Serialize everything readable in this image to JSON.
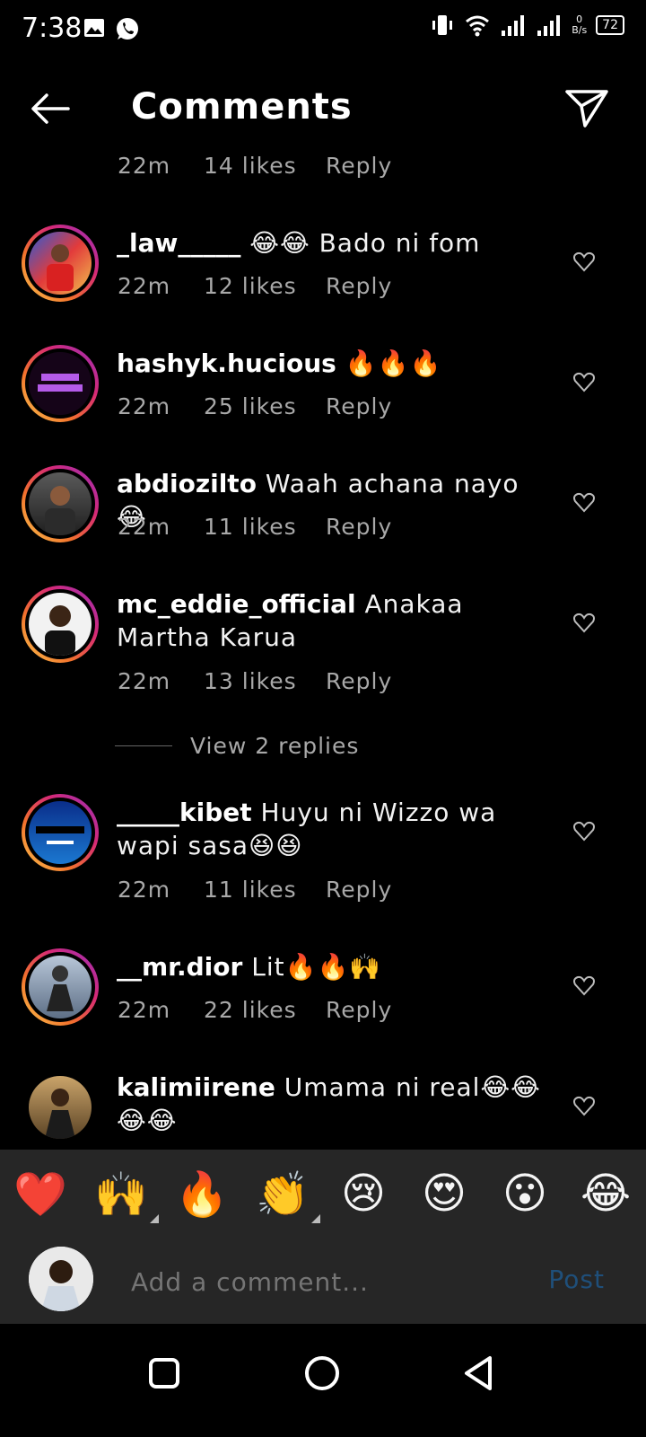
{
  "status": {
    "time": "7:38",
    "battery": "72",
    "net_speed_value": "0",
    "net_speed_unit": "B/s"
  },
  "header": {
    "title": "Comments"
  },
  "top_partial": {
    "time": "22m",
    "likes": "14 likes",
    "reply": "Reply"
  },
  "comments": [
    {
      "user": "_law_____",
      "text": " 😂😂 Bado ni fom",
      "time": "22m",
      "likes": "12 likes",
      "reply": "Reply"
    },
    {
      "user": "hashyk.hucious",
      "text": " 🔥🔥🔥",
      "time": "22m",
      "likes": "25 likes",
      "reply": "Reply"
    },
    {
      "user": "abdiozilto",
      "text": " Waah achana nayo😂",
      "time": "22m",
      "likes": "11 likes",
      "reply": "Reply"
    },
    {
      "user": "mc_eddie_official",
      "text": " Anakaa Martha Karua",
      "time": "22m",
      "likes": "13 likes",
      "reply": "Reply"
    },
    {
      "user": "_____kibet",
      "text": " Huyu ni Wizzo wa wapi sasa😆😆",
      "time": "22m",
      "likes": "11 likes",
      "reply": "Reply"
    },
    {
      "user": "__mr.dior",
      "text": " Lit🔥🔥🙌",
      "time": "22m",
      "likes": "22 likes",
      "reply": "Reply"
    },
    {
      "user": "kalimiirene",
      "text": " Umama ni real😂😂😂😂"
    }
  ],
  "view_replies": "View 2 replies",
  "reactions": [
    "❤️",
    "🙌",
    "🔥",
    "👏",
    "😢",
    "😍",
    "😮",
    "😂"
  ],
  "input": {
    "placeholder": "Add a comment...",
    "post_label": "Post"
  },
  "colors": {
    "background": "#000000",
    "panel": "#262626",
    "post": "#1f4f7a",
    "muted": "#a8a8a8"
  }
}
